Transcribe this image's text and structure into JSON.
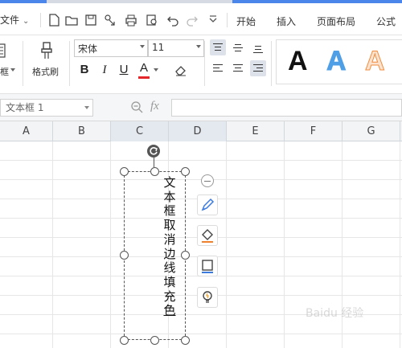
{
  "menu": {
    "file_label": "文件",
    "tabs": [
      "开始",
      "插入",
      "页面布局",
      "公式"
    ]
  },
  "ribbon": {
    "textbox_label": "框",
    "format_painter_label": "格式刷",
    "font_name": "宋体",
    "font_size": "11",
    "bold": "B",
    "italic": "I",
    "underline": "U",
    "font_color_glyph": "A",
    "font_color_hex": "#e3262a",
    "wordart_samples": [
      "A",
      "A",
      "A"
    ],
    "wordart_colors": [
      "#111111",
      "#4f9fe6",
      "#f28c3c"
    ]
  },
  "formula_bar": {
    "name_box": "文本框 1",
    "fx_label": "fx",
    "formula_value": ""
  },
  "grid": {
    "columns": [
      "A",
      "B",
      "C",
      "D",
      "E",
      "F",
      "G"
    ]
  },
  "textbox": {
    "chars": [
      "文",
      "本",
      "框",
      "取",
      "消",
      "边",
      "线",
      "填",
      "充",
      "色"
    ]
  },
  "float_toolbar": {
    "icons": [
      "collapse-icon",
      "pen-style-icon",
      "fill-color-icon",
      "outline-icon",
      "bulb-icon"
    ]
  },
  "watermark": "Baidu 经验"
}
